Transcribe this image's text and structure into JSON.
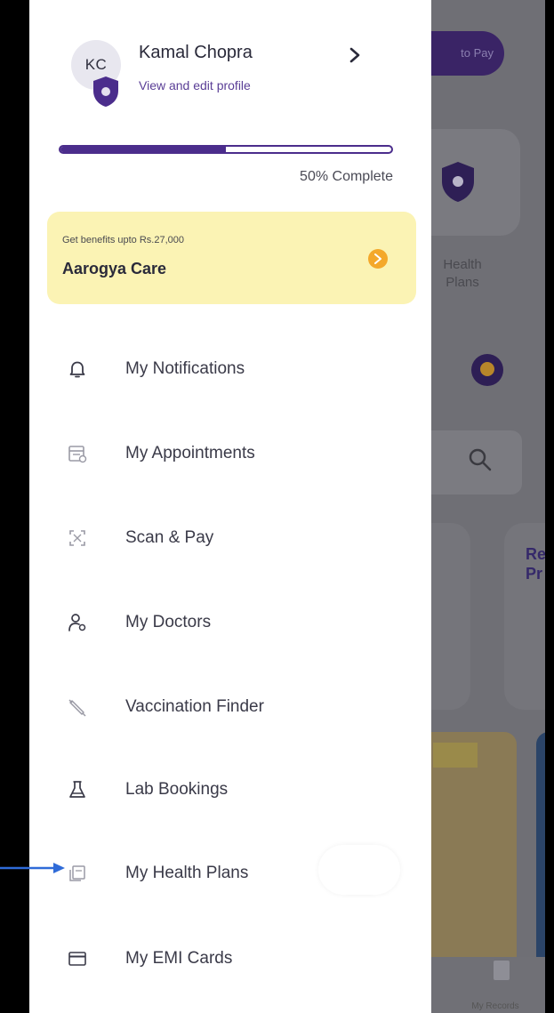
{
  "profile": {
    "initials": "KC",
    "name": "Kamal Chopra",
    "edit_label": "View and edit profile"
  },
  "progress": {
    "percent": 50,
    "label": "50% Complete"
  },
  "benefit": {
    "subtitle": "Get benefits upto Rs.27,000",
    "title": "Aarogya Care"
  },
  "menu": [
    {
      "label": "My Notifications",
      "icon": "bell-icon"
    },
    {
      "label": "My Appointments",
      "icon": "calendar-icon"
    },
    {
      "label": "Scan & Pay",
      "icon": "scan-icon"
    },
    {
      "label": "My Doctors",
      "icon": "doctor-icon"
    },
    {
      "label": "Vaccination Finder",
      "icon": "syringe-icon"
    },
    {
      "label": "Lab Bookings",
      "icon": "flask-icon"
    },
    {
      "label": "My Health Plans",
      "icon": "health-plan-icon"
    },
    {
      "label": "My EMI Cards",
      "icon": "card-icon"
    }
  ],
  "background": {
    "pay_label": "to Pay",
    "card_label": "Health Plans",
    "tile_text": "Re Pr",
    "records_label": "My Records"
  },
  "colors": {
    "primary": "#4b2d8c",
    "benefit_bg": "#fbf3b4",
    "accent": "#f4a82a",
    "pointer": "#2f6bd8"
  }
}
